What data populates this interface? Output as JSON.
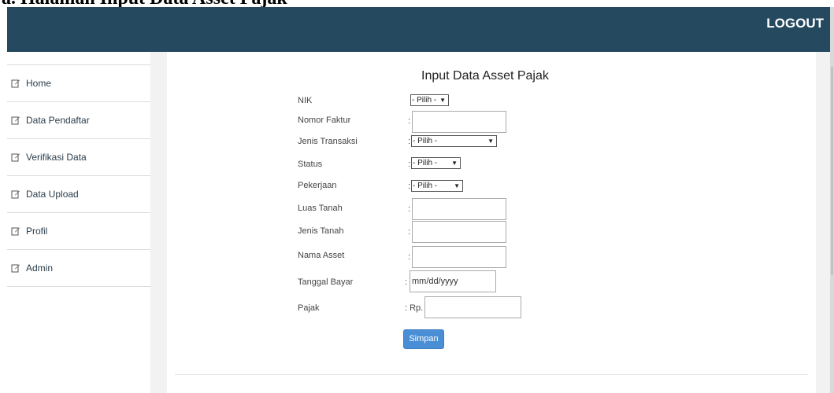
{
  "caption": "a.  Halaman Input Data Asset Pajak",
  "header": {
    "logout_label": "LOGOUT",
    "bg_color": "#25495f"
  },
  "sidebar": {
    "items": [
      {
        "label": "Home",
        "icon": "edit-icon"
      },
      {
        "label": "Data Pendaftar",
        "icon": "edit-icon"
      },
      {
        "label": "Verifikasi Data",
        "icon": "edit-icon"
      },
      {
        "label": "Data Upload",
        "icon": "edit-icon"
      },
      {
        "label": "Profil",
        "icon": "edit-icon"
      },
      {
        "label": "Admin",
        "icon": "edit-icon"
      }
    ]
  },
  "form": {
    "title": "Input Data Asset Pajak",
    "colon": ":",
    "fields": {
      "nik": {
        "label": "NIK",
        "value": "- Pilih -"
      },
      "nomor_faktur": {
        "label": "Nomor Faktur",
        "value": ""
      },
      "jenis_transaksi": {
        "label": "Jenis Transaksi",
        "value": "- Pilih -"
      },
      "status": {
        "label": "Status",
        "value": "- Pilih -"
      },
      "pekerjaan": {
        "label": "Pekerjaan",
        "value": "- Pilih -"
      },
      "luas_tanah": {
        "label": "Luas Tanah",
        "value": ""
      },
      "jenis_tanah": {
        "label": "Jenis Tanah",
        "value": ""
      },
      "nama_asset": {
        "label": "Nama Asset",
        "value": ""
      },
      "tanggal_bayar": {
        "label": "Tanggal Bayar",
        "placeholder": "mm/dd/yyyy"
      },
      "pajak": {
        "label": "Pajak",
        "prefix": ": Rp.",
        "value": ""
      }
    },
    "submit_label": "Simpan",
    "button_color": "#4a8fd6"
  }
}
